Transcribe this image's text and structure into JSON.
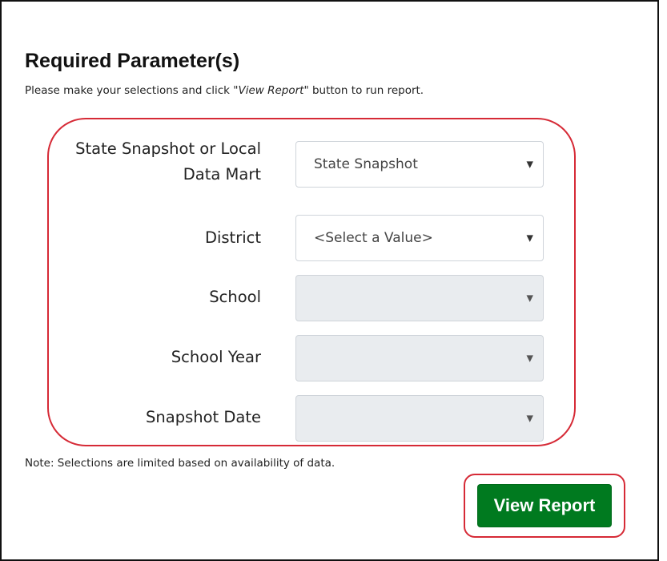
{
  "header": {
    "title": "Required Parameter(s)",
    "instructions_prefix": "Please make your selections and click \"",
    "instructions_emphasis": "View Report",
    "instructions_suffix": "\" button to run report."
  },
  "parameters": [
    {
      "label_lines": [
        "State Snapshot or Local",
        "Data Mart"
      ],
      "selected_value": "State Snapshot",
      "disabled": false
    },
    {
      "label_lines": [
        "District"
      ],
      "selected_value": "<Select a Value>",
      "disabled": false
    },
    {
      "label_lines": [
        "School"
      ],
      "selected_value": "",
      "disabled": true
    },
    {
      "label_lines": [
        "School Year"
      ],
      "selected_value": "",
      "disabled": true
    },
    {
      "label_lines": [
        "Snapshot Date"
      ],
      "selected_value": "",
      "disabled": true
    }
  ],
  "note": "Note: Selections are limited based on availability of data.",
  "actions": {
    "view_report_label": "View Report"
  },
  "icons": {
    "dropdown": "chevron-down-icon",
    "dropdown_glyph": "▼"
  },
  "colors": {
    "highlight_outline": "#d62a36",
    "button_green": "#007a1f",
    "disabled_field": "#e9ecef"
  }
}
